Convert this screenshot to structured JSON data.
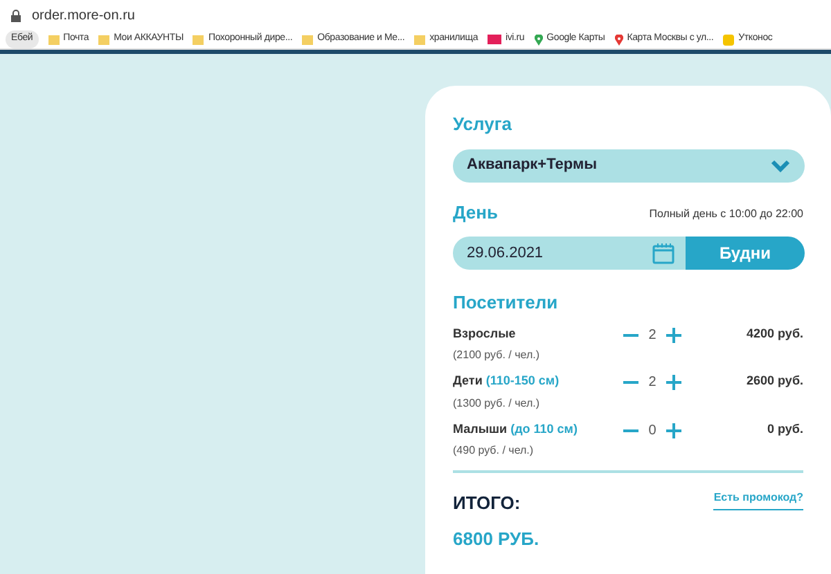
{
  "browser": {
    "url": "order.more-on.ru",
    "bookmarks": [
      {
        "label": "Ебей",
        "kind": "pill"
      },
      {
        "label": "Почта",
        "kind": "folder"
      },
      {
        "label": "Мои АККАУНТЫ",
        "kind": "folder"
      },
      {
        "label": "Похоронный дире...",
        "kind": "folder"
      },
      {
        "label": "Образование и Ме...",
        "kind": "folder"
      },
      {
        "label": "хранилища",
        "kind": "folder"
      },
      {
        "label": "ivi.ru",
        "kind": "ivi"
      },
      {
        "label": "Google Карты",
        "kind": "pin"
      },
      {
        "label": "Карта Москвы с ул...",
        "kind": "redpin"
      },
      {
        "label": "Утконос",
        "kind": "duck"
      }
    ]
  },
  "order": {
    "service_title": "Услуга",
    "service": "Аквапарк+Термы",
    "day_title": "День",
    "day_hours": "Полный день с 10:00 до 22:00",
    "date": "29.06.2021",
    "day_type": "Будни",
    "visitors_title": "Посетители",
    "visitors": [
      {
        "name": "Взрослые",
        "price": "(2100 руб. / чел.)",
        "count": "2",
        "sum": "4200 руб."
      },
      {
        "name": "Дети",
        "note": "(110-150 см)",
        "price": "(1300 руб. / чел.)",
        "count": "2",
        "sum": "2600 руб."
      },
      {
        "name": "Малыши",
        "note": "(до 110 см)",
        "price": "(490 руб. / чел.)",
        "count": "0",
        "sum": "0 руб."
      }
    ],
    "total_label": "ИТОГО:",
    "total": "6800 РУБ.",
    "promo_link": "Есть промокод?"
  }
}
